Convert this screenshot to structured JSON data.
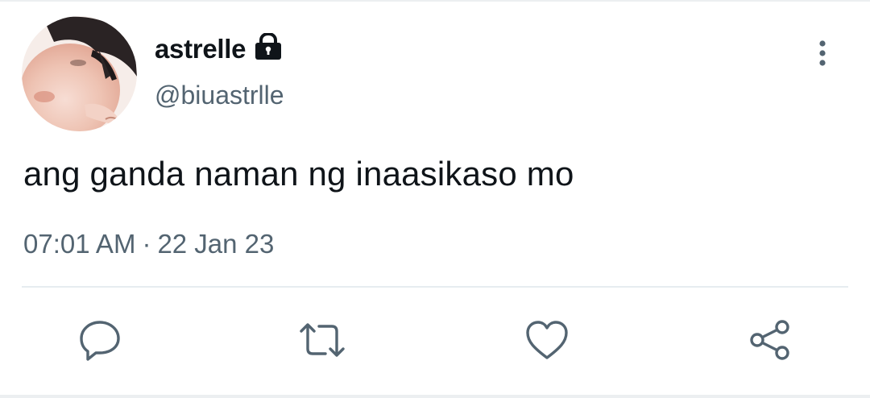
{
  "tweet": {
    "display_name": "astrelle",
    "handle": "@biuastrlle",
    "text": "ang ganda naman ng inaasikaso mo",
    "time": "07:01 AM",
    "separator": "·",
    "date": "22 Jan 23",
    "protected": true
  },
  "icons": {
    "lock": "lock-icon",
    "more": "more-vertical-icon",
    "reply": "reply-icon",
    "retweet": "retweet-icon",
    "like": "heart-icon",
    "share": "share-icon"
  },
  "colors": {
    "text_primary": "#0f1419",
    "text_secondary": "#536471",
    "icon": "#536471",
    "divider": "#e6ecf0"
  }
}
